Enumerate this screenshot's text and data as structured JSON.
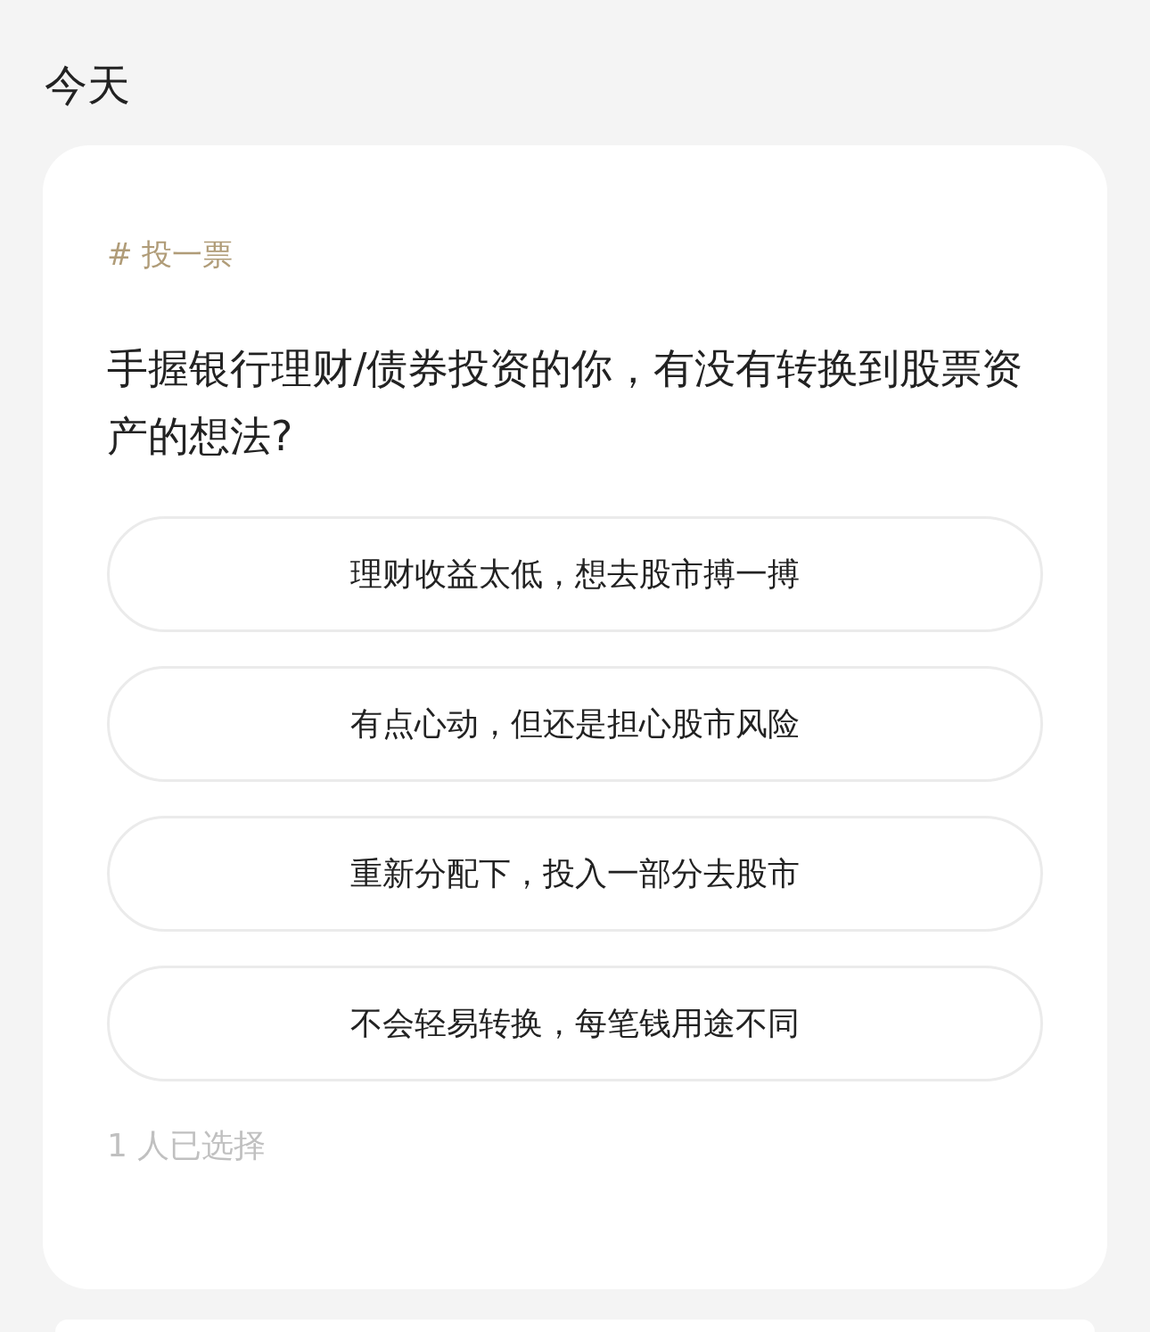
{
  "section_title": "今天",
  "poll": {
    "tag": "# 投一票",
    "question": "手握银行理财/债券投资的你，有没有转换到股票资产的想法?",
    "options": [
      {
        "label": "理财收益太低，想去股市搏一搏",
        "selected": false
      },
      {
        "label": "有点心动，但还是担心股市风险",
        "selected": false
      },
      {
        "label": "重新分配下，投入一部分去股市",
        "selected": false
      },
      {
        "label": "不会轻易转换，每笔钱用途不同",
        "selected": false
      }
    ],
    "participants": "1 人已选择"
  }
}
